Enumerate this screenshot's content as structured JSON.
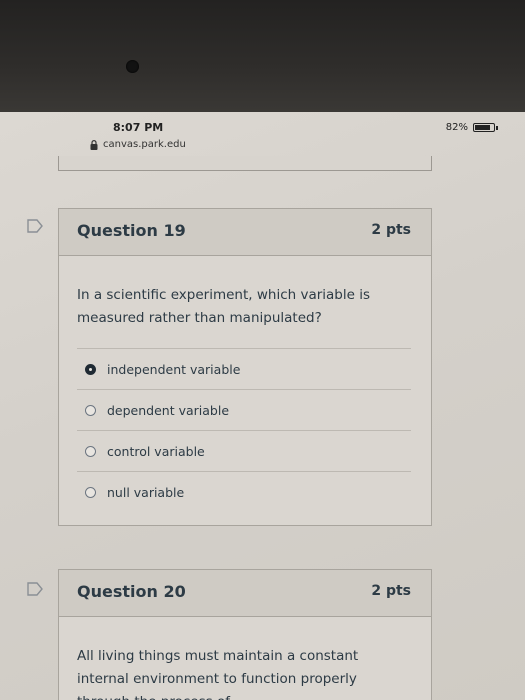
{
  "status": {
    "time": "8:07 PM",
    "url": "canvas.park.edu",
    "battery": "82%",
    "battery_level": 0.82
  },
  "questions": [
    {
      "title": "Question 19",
      "points": "2 pts",
      "text": "In a scientific experiment, which variable is measured rather than manipulated?",
      "answers": [
        {
          "label": "independent variable",
          "selected": true
        },
        {
          "label": "dependent variable",
          "selected": false
        },
        {
          "label": "control variable",
          "selected": false
        },
        {
          "label": "null variable",
          "selected": false
        }
      ]
    },
    {
      "title": "Question 20",
      "points": "2 pts",
      "text": "All living things must maintain a constant internal environment to function properly through the process of"
    }
  ],
  "icons": {
    "flag": "flag-icon",
    "lock": "lock-icon",
    "battery": "battery-icon",
    "radio": "radio-button"
  },
  "colors": {
    "text": "#2d3b45",
    "border": "#a8a49d"
  }
}
